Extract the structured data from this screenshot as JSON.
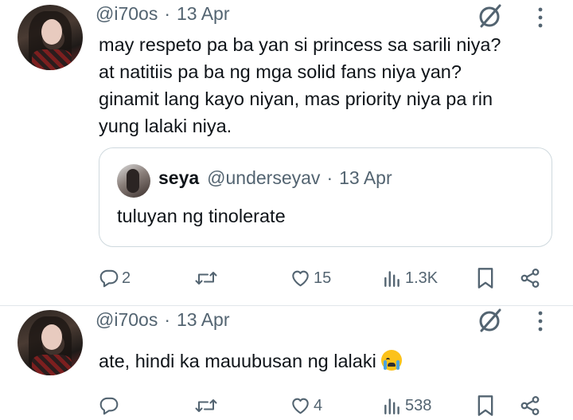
{
  "tweets": [
    {
      "handle": "@i70os",
      "separator": "·",
      "date": "13 Apr",
      "text_lines": [
        "may respeto pa ba yan si princess sa sarili niya?",
        "at natitiis pa ba ng mga solid fans niya yan?",
        "ginamit lang kayo niyan, mas priority niya pa rin",
        "yung lalaki niya."
      ],
      "quote": {
        "name": "seya",
        "handle": "@underseyav",
        "separator": "·",
        "date": "13 Apr",
        "text": "tuluyan ng tinolerate"
      },
      "actions": {
        "replies": "2",
        "likes": "15",
        "views": "1.3K"
      }
    },
    {
      "handle": "@i70os",
      "separator": "·",
      "date": "13 Apr",
      "text": "ate, hindi ka mauubusan ng lalaki",
      "emoji": "loudly-crying-face",
      "actions": {
        "likes": "4",
        "views": "538"
      }
    }
  ],
  "colors": {
    "text": "#0f1419",
    "secondary": "#536471",
    "border": "#cfd9de",
    "divider": "#e1e6ea"
  },
  "icons": [
    "grok-icon",
    "more-icon",
    "reply-icon",
    "retweet-icon",
    "like-icon",
    "views-icon",
    "bookmark-icon",
    "share-icon"
  ]
}
